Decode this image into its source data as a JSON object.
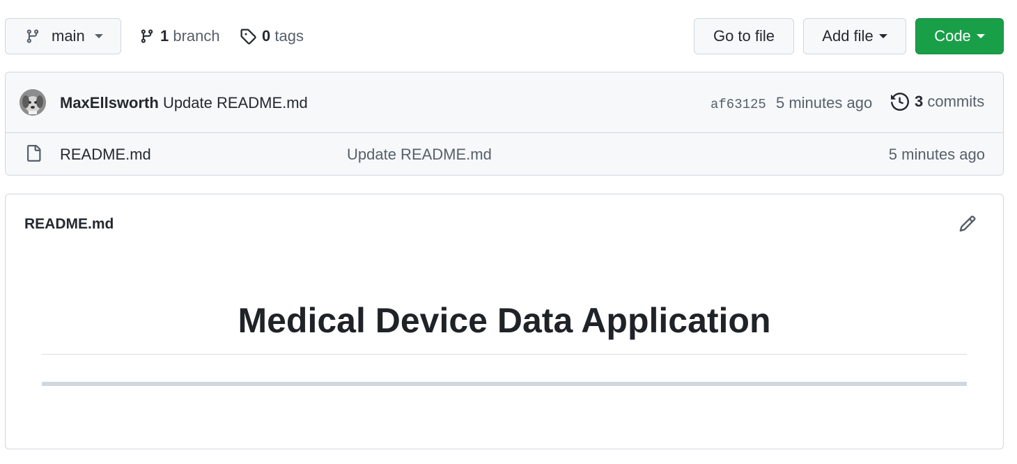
{
  "toolbar": {
    "branch_selector": "main",
    "branch_count": "1",
    "branch_label": "branch",
    "tag_count": "0",
    "tag_label": "tags",
    "go_to_file": "Go to file",
    "add_file": "Add file",
    "code": "Code",
    "code_color": "#1f883d"
  },
  "latest_commit": {
    "author": "MaxEllsworth",
    "message": "Update README.md",
    "sha": "af63125",
    "time": "5 minutes ago",
    "commit_count": "3",
    "commit_label": "commits"
  },
  "files": [
    {
      "name": "README.md",
      "message": "Update README.md",
      "time": "5 minutes ago"
    }
  ],
  "readme": {
    "filename": "README.md",
    "heading": "Medical Device Data Application"
  }
}
